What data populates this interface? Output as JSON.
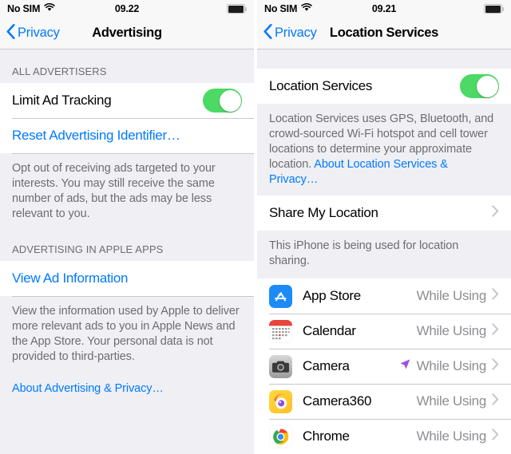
{
  "theme": {
    "tint_blue": "#007aff",
    "toggle_green": "#4cd964",
    "secondary_gray": "#8e8e93",
    "group_bg": "#efeff4",
    "cell_bg": "#ffffff",
    "location_arrow_purple": "#a24ce0"
  },
  "left_screen": {
    "status_bar": {
      "carrier": "No SIM",
      "wifi_icon": "wifi-icon",
      "time": "09.22",
      "battery_icon": "battery-full-icon"
    },
    "nav": {
      "back_icon": "chevron-left-icon",
      "back_label": "Privacy",
      "title": "Advertising"
    },
    "sections": [
      {
        "header": "ALL ADVERTISERS",
        "rows": [
          {
            "type": "toggle",
            "label": "Limit Ad Tracking",
            "toggle_on": true
          },
          {
            "type": "link",
            "label": "Reset Advertising Identifier…"
          }
        ],
        "note": "Opt out of receiving ads targeted to your interests. You may still receive the same number of ads, but the ads may be less relevant to you."
      },
      {
        "header": "ADVERTISING IN APPLE APPS",
        "rows": [
          {
            "type": "link",
            "label": "View Ad Information"
          }
        ],
        "note": "View the information used by Apple to deliver more relevant ads to you in Apple News and the App Store. Your personal data is not provided to third-parties.",
        "footer_link": "About Advertising & Privacy…"
      }
    ]
  },
  "right_screen": {
    "status_bar": {
      "carrier": "No SIM",
      "wifi_icon": "wifi-icon",
      "time": "09.21",
      "battery_icon": "battery-full-icon"
    },
    "nav": {
      "back_icon": "chevron-left-icon",
      "back_label": "Privacy",
      "title": "Location Services"
    },
    "master_toggle_row": {
      "label": "Location Services",
      "toggle_on": true
    },
    "master_note_text": "Location Services uses GPS, Bluetooth, and crowd-sourced Wi-Fi hotspot and cell tower locations to determine your approximate location. ",
    "master_note_link": "About Location Services & Privacy…",
    "share_row": {
      "label": "Share My Location",
      "chevron_icon": "chevron-right-icon"
    },
    "share_note": "This iPhone is being used for location sharing.",
    "apps": [
      {
        "icon": "app-store-icon",
        "name": "App Store",
        "permission": "While Using",
        "active_arrow": false,
        "chevron_icon": "chevron-right-icon"
      },
      {
        "icon": "calendar-icon",
        "name": "Calendar",
        "permission": "While Using",
        "active_arrow": false,
        "chevron_icon": "chevron-right-icon"
      },
      {
        "icon": "camera-icon",
        "name": "Camera",
        "permission": "While Using",
        "active_arrow": true,
        "chevron_icon": "chevron-right-icon"
      },
      {
        "icon": "camera360-icon",
        "name": "Camera360",
        "permission": "While Using",
        "active_arrow": false,
        "chevron_icon": "chevron-right-icon"
      },
      {
        "icon": "chrome-icon",
        "name": "Chrome",
        "permission": "While Using",
        "active_arrow": false,
        "chevron_icon": "chevron-right-icon"
      }
    ]
  }
}
